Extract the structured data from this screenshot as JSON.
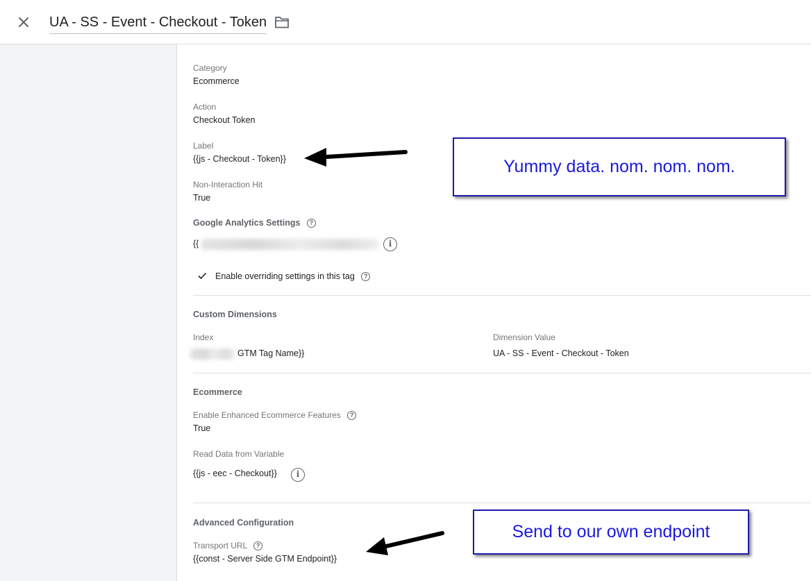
{
  "header": {
    "title": "UA - SS - Event - Checkout - Token"
  },
  "fields": {
    "category_label": "Category",
    "category_value": "Ecommerce",
    "action_label": "Action",
    "action_value": "Checkout Token",
    "label_label": "Label",
    "label_value": "{{js - Checkout - Token}}",
    "non_interaction_label": "Non-Interaction Hit",
    "non_interaction_value": "True",
    "ga_settings_label": "Google Analytics Settings",
    "ga_settings_value_prefix": "{{",
    "override_label": "Enable overriding settings in this tag"
  },
  "custom_dimensions": {
    "heading": "Custom Dimensions",
    "index_label": "Index",
    "dimension_value_label": "Dimension Value",
    "index_value_suffix": "GTM Tag Name}}",
    "dimension_value": "UA - SS - Event - Checkout - Token"
  },
  "ecommerce": {
    "heading": "Ecommerce",
    "enhanced_label": "Enable Enhanced Ecommerce Features",
    "enhanced_value": "True",
    "read_data_label": "Read Data from Variable",
    "read_data_value": "{{js - eec - Checkout}}"
  },
  "advanced": {
    "heading": "Advanced Configuration",
    "transport_label": "Transport URL",
    "transport_value": "{{const - Server Side GTM Endpoint}}"
  },
  "annotations": {
    "callout_top": "Yummy data. nom. nom. nom.",
    "callout_bottom": "Send to our own endpoint"
  },
  "icons": {
    "close": "close-icon",
    "folder": "folder-icon",
    "help": "help-icon",
    "info": "info-icon",
    "check": "check-icon"
  },
  "colors": {
    "callout_border": "#1a1aa8",
    "callout_text": "#1a1adb",
    "sidebar_bg": "#f1f3f4"
  }
}
